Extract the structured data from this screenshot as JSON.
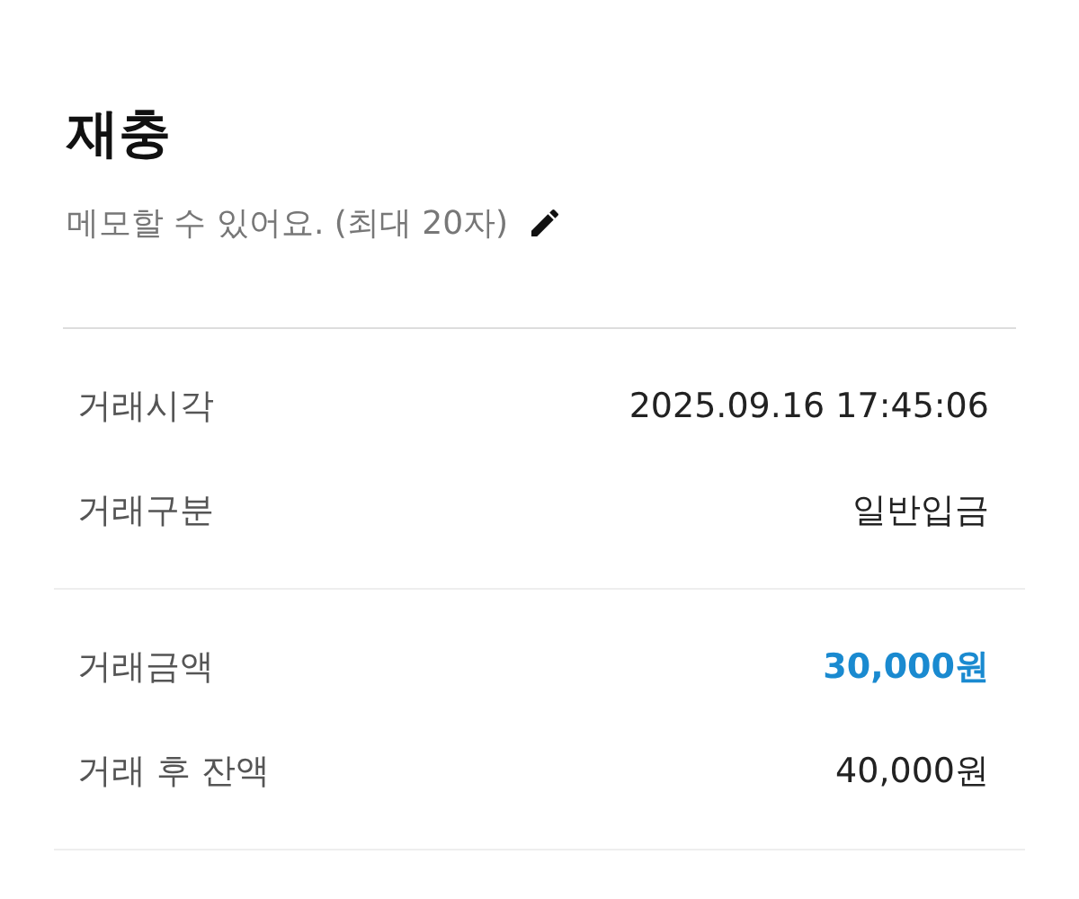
{
  "title": "재충",
  "memo": {
    "placeholder": "메모할 수 있어요. (최대 20자)"
  },
  "groups": [
    {
      "rows": [
        {
          "label": "거래시각",
          "value": "2025.09.16 17:45:06",
          "kind": "plain"
        },
        {
          "label": "거래구분",
          "value": "일반입금",
          "kind": "plain"
        }
      ]
    },
    {
      "rows": [
        {
          "label": "거래금액",
          "value": "30,000원",
          "kind": "highlight"
        },
        {
          "label": "거래 후 잔액",
          "value": "40,000원",
          "kind": "plain"
        }
      ]
    }
  ]
}
